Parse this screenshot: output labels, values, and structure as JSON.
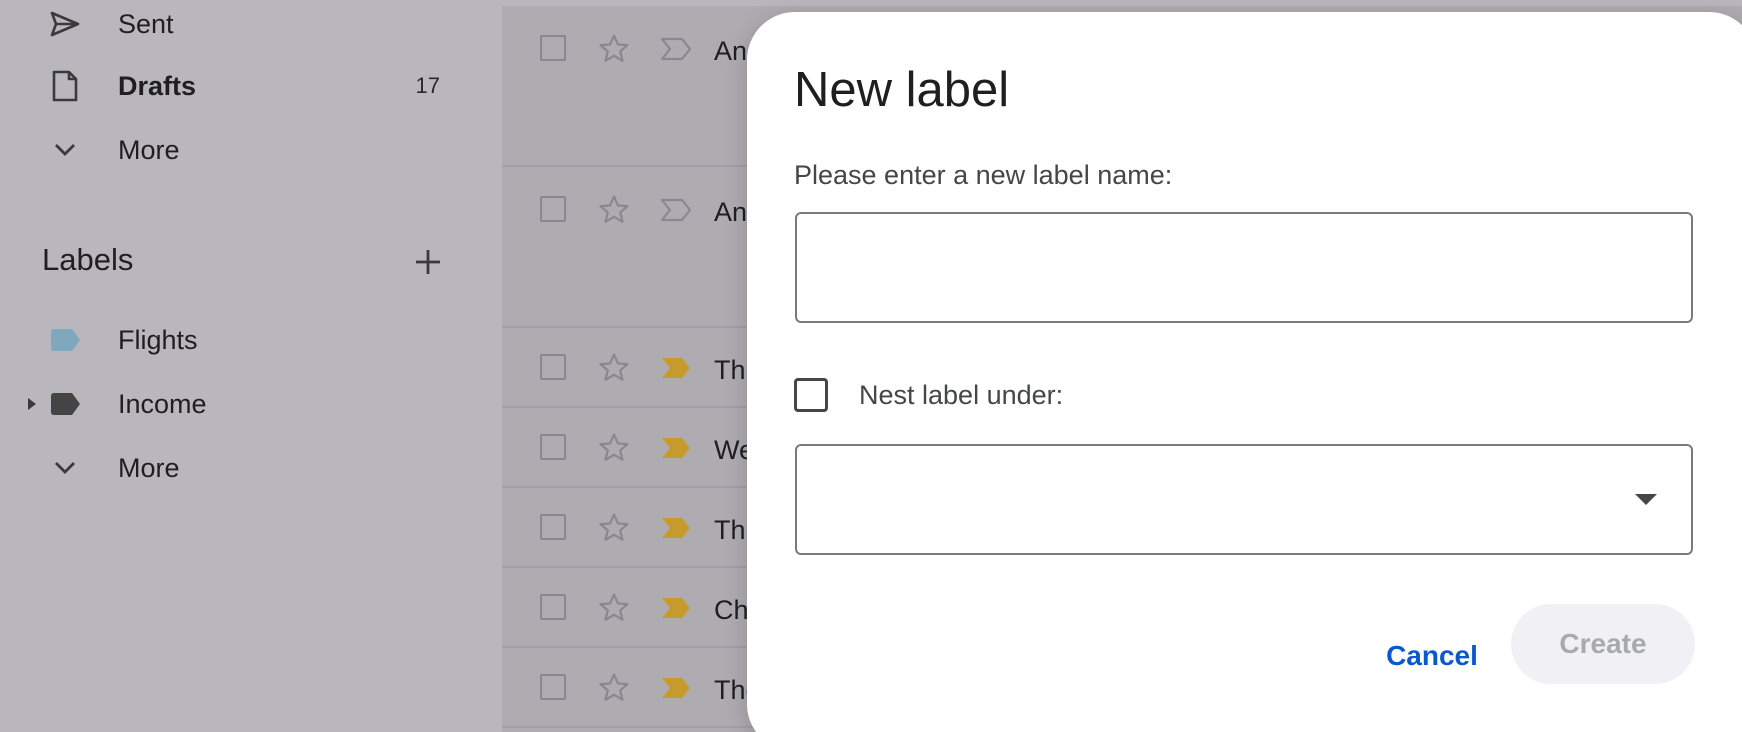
{
  "sidebar": {
    "items": [
      {
        "label": "Sent",
        "icon": "send-icon"
      },
      {
        "label": "Drafts",
        "icon": "draft-icon",
        "count": "17",
        "bold": true
      },
      {
        "label": "More",
        "icon": "chevron-down-icon"
      }
    ],
    "labels_heading": "Labels",
    "labels_add_icon": "plus-icon",
    "labels": [
      {
        "label": "Flights",
        "color": "#7fa8be"
      },
      {
        "label": "Income",
        "color": "#444444",
        "has_children": true
      }
    ],
    "labels_more": "More"
  },
  "mail_list": {
    "rows": [
      {
        "subject": "And",
        "important": false
      },
      {
        "subject": "An",
        "important": false
      },
      {
        "subject": "Th",
        "important": true
      },
      {
        "subject": "We",
        "important": true
      },
      {
        "subject": "Th",
        "important": true
      },
      {
        "subject": "Ch",
        "important": true
      },
      {
        "subject": "The",
        "important": true
      }
    ],
    "important_color": "#c69b2c"
  },
  "dialog": {
    "title": "New label",
    "prompt": "Please enter a new label name:",
    "name_value": "",
    "nest_checked": false,
    "nest_label": "Nest label under:",
    "nest_selected": "",
    "cancel_label": "Cancel",
    "create_label": "Create",
    "accent_color": "#0b57d0"
  }
}
